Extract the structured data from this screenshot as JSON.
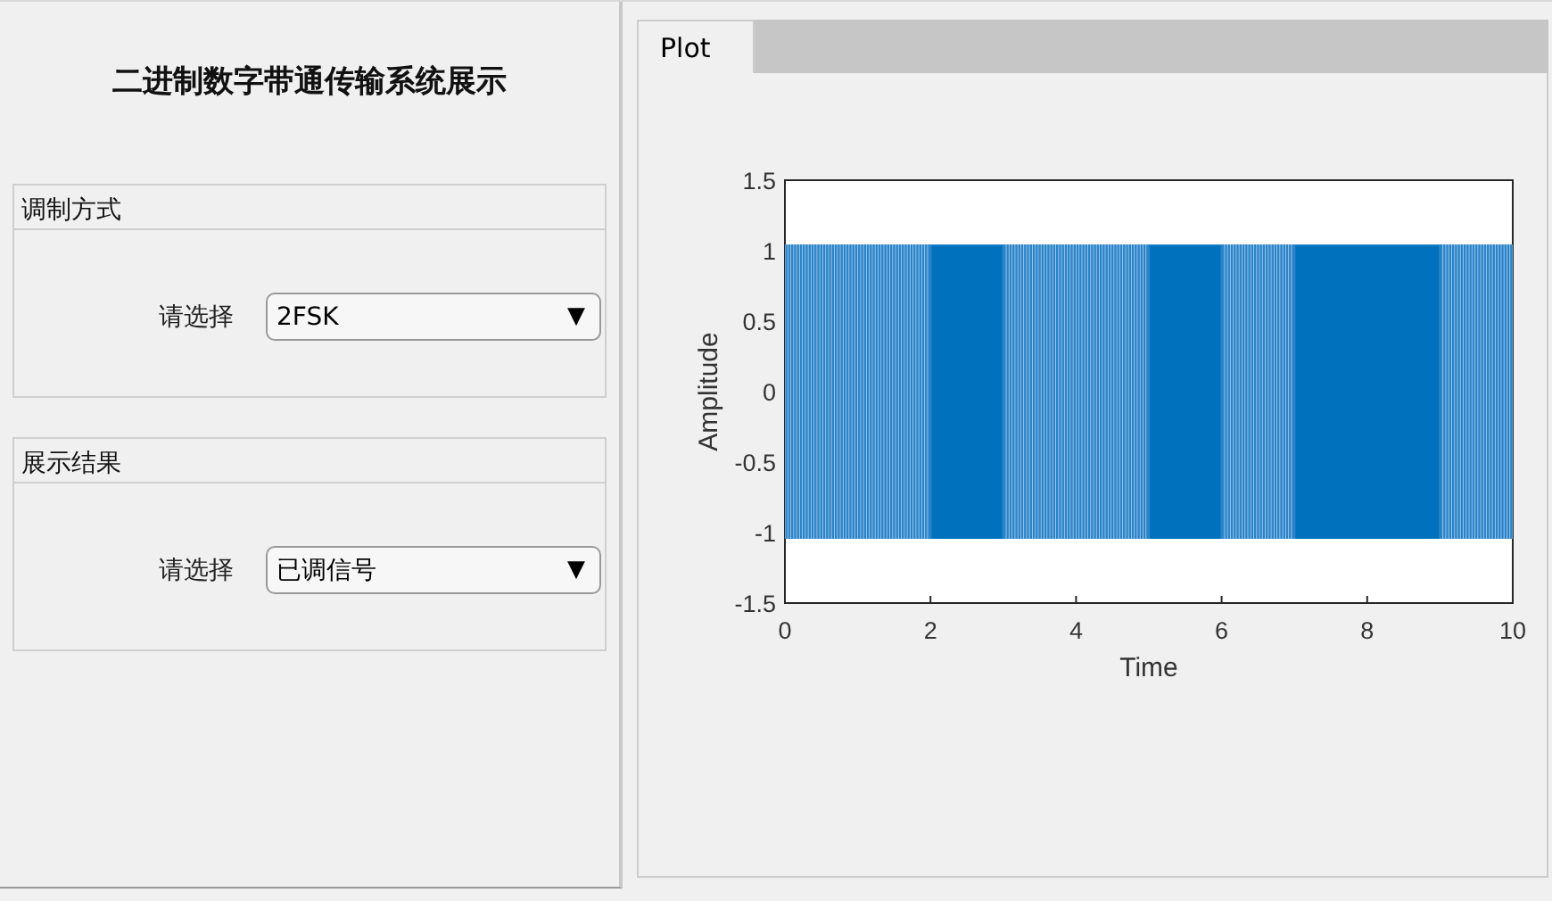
{
  "title": "二进制数字带通传输系统展示",
  "panels": [
    {
      "title": "调制方式",
      "label": "请选择",
      "value": "2FSK",
      "arrow": "▼"
    },
    {
      "title": "展示结果",
      "label": "请选择",
      "value": "已调信号",
      "arrow": "▼"
    }
  ],
  "tabs": [
    {
      "label": "Plot",
      "selected": true
    }
  ],
  "chart_data": {
    "type": "line",
    "xlabel": "Time",
    "ylabel": "Amplitude",
    "xlim": [
      0,
      10
    ],
    "ylim": [
      -1.5,
      1.5
    ],
    "xticks": [
      {
        "value": 0,
        "label": "0"
      },
      {
        "value": 2,
        "label": "2"
      },
      {
        "value": 4,
        "label": "4"
      },
      {
        "value": 6,
        "label": "6"
      },
      {
        "value": 8,
        "label": "8"
      },
      {
        "value": 10,
        "label": "10"
      }
    ],
    "yticks": [
      {
        "value": 1.5,
        "label": "1.5"
      },
      {
        "value": 1,
        "label": "1"
      },
      {
        "value": 0.5,
        "label": "0.5"
      },
      {
        "value": 0,
        "label": "0"
      },
      {
        "value": -0.5,
        "label": "-0.5"
      },
      {
        "value": -1,
        "label": "-1"
      },
      {
        "value": -1.5,
        "label": "-1.5"
      }
    ]
  }
}
